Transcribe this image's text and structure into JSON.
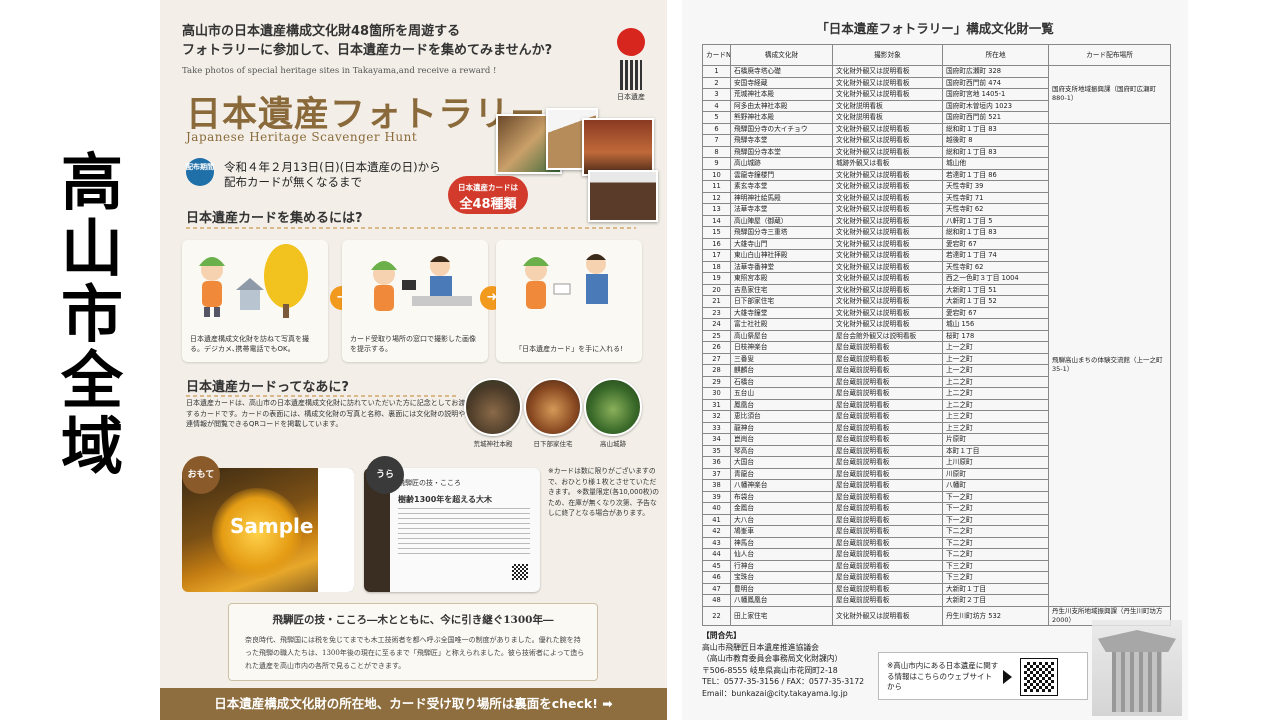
{
  "caption": {
    "chars": [
      "高",
      "山",
      "市",
      "全",
      "域"
    ]
  },
  "flyer": {
    "intro_line1": "高山市の日本遺産構成文化財48箇所を周遊する",
    "intro_line2": "フォトラリーに参加して、日本遺産カードを集めてみませんか?",
    "intro_en": "Take photos of special heritage sites in Takayama,and receive a reward !",
    "logo_caption": "日本遺産",
    "title": "日本遺産フォトラリー",
    "subtitle": "Japanese Heritage Scavenger Hunt",
    "period_badge": "配布期間",
    "period_line1": "令和４年２月13日(日)(日本遺産の日)から",
    "period_line2": "配布カードが無くなるまで",
    "count_badge_small": "日本遺産カードは",
    "count_badge_large": "全48種類",
    "how_heading": "日本遺産カードを集めるには?",
    "steps": [
      {
        "caption": "日本遺産構成文化財を訪ねて写真を撮る。デジカメ､携帯電話でもOK。"
      },
      {
        "caption": "カード受取り場所の窓口で撮影した画像を提示する。"
      },
      {
        "caption": "「日本遺産カード」を手に入れる!"
      }
    ],
    "about_heading": "日本遺産カードってなあに?",
    "about_text": "日本遺産カードは、高山市の日本遺産構成文化財に訪れていただいた方に記念としてお渡しするカードです。カードの表面には、構成文化財の写真と名称、裏面には文化財の説明や関連情報が閲覧できるQRコードを掲載しています。",
    "thumbs": [
      "荒城神社本殿",
      "日下部家住宅",
      "高山城跡"
    ],
    "front_label": "おもて",
    "back_label": "うら",
    "sample_text": "Sample",
    "card_back_title": "飛騨匠の技・こころ",
    "card_back_heading": "樹齢1300年を超える大木",
    "card_note": "※カードは数に限りがございますので、おひとり様１枚とさせていただきます。 ※数量限定(各10,000枚)のため、在庫が無くなり次第、予告なしに終了となる場合があります。",
    "story_heading": "飛騨匠の技・こころ―木とともに、今に引き継ぐ1300年―",
    "story_text": "奈良時代、飛騨国には税を免じてまでも木工技術者を都へ呼ぶ全国唯一の制度がありました。優れた腕を持った飛騨の職人たちは、1300年後の現在に至るまで「飛騨匠」と称えられました。彼ら技術者によって造られた遺産を高山市内の各所で見ることができます。",
    "bottom_bar": "日本遺産構成文化財の所在地、カード受け取り場所は裏面をcheck! ➡"
  },
  "page": {
    "title": "「日本遺産フォトラリー」構成文化財一覧",
    "headers": [
      "カードNo",
      "構成文化財",
      "撮影対象",
      "所在地",
      "カード配布場所"
    ],
    "rows": [
      [
        "1",
        "石橋廃寺塔心礎",
        "文化財外観又は説明看板",
        "国府町広瀬町 328"
      ],
      [
        "2",
        "安国寺経蔵",
        "文化財外観又は説明看板",
        "国府町西門前 474"
      ],
      [
        "3",
        "荒城神社本殿",
        "文化財外観又は説明看板",
        "国府町宮地 1405-1"
      ],
      [
        "4",
        "阿多由太神社本殿",
        "文化財説明看板",
        "国府町木曽垣内 1023"
      ],
      [
        "5",
        "熊野神社本殿",
        "文化財説明看板",
        "国府町西門前 521"
      ],
      [
        "6",
        "飛騨国分寺の大イチョウ",
        "文化財外観又は説明看板",
        "総和町１丁目 83"
      ],
      [
        "7",
        "飛騨寺本堂",
        "文化財外観又は説明看板",
        "越後町 8"
      ],
      [
        "8",
        "飛騨国分寺本堂",
        "文化財外観又は説明看板",
        "総和町１丁目 83"
      ],
      [
        "9",
        "高山城跡",
        "城跡外観又は看板",
        "城山他"
      ],
      [
        "10",
        "雲龍寺鐘楼門",
        "文化財外観又は説明看板",
        "若達町１丁目 86"
      ],
      [
        "11",
        "素玄寺本堂",
        "文化財外観又は説明看板",
        "天性寺町 39"
      ],
      [
        "12",
        "神明神社絵馬殿",
        "文化財外観又は説明看板",
        "天性寺町 71"
      ],
      [
        "13",
        "法華寺本堂",
        "文化財外観又は説明看板",
        "天性寺町 62"
      ],
      [
        "14",
        "高山陣屋（御蔵）",
        "文化財外観又は説明看板",
        "八軒町１丁目 5"
      ],
      [
        "15",
        "飛騨国分寺三重塔",
        "文化財外観又は説明看板",
        "総和町１丁目 83"
      ],
      [
        "16",
        "大雄寺山門",
        "文化財外観又は説明看板",
        "愛宕町 67"
      ],
      [
        "17",
        "東山白山神社拝殿",
        "文化財外観又は説明看板",
        "若達町１丁目 74"
      ],
      [
        "18",
        "法華寺番神堂",
        "文化財外観又は説明看板",
        "天性寺町 62"
      ],
      [
        "19",
        "東照宮本殿",
        "文化財外観又は説明看板",
        "西之一色町３丁目 1004"
      ],
      [
        "20",
        "吉島家住宅",
        "文化財外観又は説明看板",
        "大新町１丁目 51"
      ],
      [
        "21",
        "日下部家住宅",
        "文化財外観又は説明看板",
        "大新町１丁目 52"
      ],
      [
        "23",
        "大雄寺鐘堂",
        "文化財外観又は説明看板",
        "愛宕町 67"
      ],
      [
        "24",
        "富士社社殿",
        "文化財外観又は説明看板",
        "城山 156"
      ],
      [
        "25",
        "高山祭屋台",
        "屋台会館外観又は説明看板",
        "桜町 178"
      ],
      [
        "26",
        "日枝神楽台",
        "屋台蔵前説明看板",
        "上一之町"
      ],
      [
        "27",
        "三番叟",
        "屋台蔵前説明看板",
        "上一之町"
      ],
      [
        "28",
        "麒麟台",
        "屋台蔵前説明看板",
        "上一之町"
      ],
      [
        "29",
        "石橋台",
        "屋台蔵前説明看板",
        "上二之町"
      ],
      [
        "30",
        "五台山",
        "屋台蔵前説明看板",
        "上二之町"
      ],
      [
        "31",
        "鳳凰台",
        "屋台蔵前説明看板",
        "上二之町"
      ],
      [
        "32",
        "恵比須台",
        "屋台蔵前説明看板",
        "上三之町"
      ],
      [
        "33",
        "龍神台",
        "屋台蔵前説明看板",
        "上三之町"
      ],
      [
        "34",
        "崑崗台",
        "屋台蔵前説明看板",
        "片原町"
      ],
      [
        "35",
        "琴高台",
        "屋台蔵前説明看板",
        "本町１丁目"
      ],
      [
        "36",
        "大国台",
        "屋台蔵前説明看板",
        "上川原町"
      ],
      [
        "37",
        "青龍台",
        "屋台蔵前説明看板",
        "川原町"
      ],
      [
        "38",
        "八幡神楽台",
        "屋台蔵前説明看板",
        "八幡町"
      ],
      [
        "39",
        "布袋台",
        "屋台蔵前説明看板",
        "下一之町"
      ],
      [
        "40",
        "金鳳台",
        "屋台蔵前説明看板",
        "下一之町"
      ],
      [
        "41",
        "大八台",
        "屋台蔵前説明看板",
        "下一之町"
      ],
      [
        "42",
        "鳩峯車",
        "屋台蔵前説明看板",
        "下二之町"
      ],
      [
        "43",
        "神馬台",
        "屋台蔵前説明看板",
        "下二之町"
      ],
      [
        "44",
        "仙人台",
        "屋台蔵前説明看板",
        "下二之町"
      ],
      [
        "45",
        "行神台",
        "屋台蔵前説明看板",
        "下三之町"
      ],
      [
        "46",
        "宝珠台",
        "屋台蔵前説明看板",
        "下三之町"
      ],
      [
        "47",
        "豊明台",
        "屋台蔵前説明看板",
        "大新町１丁目"
      ],
      [
        "48",
        "八幡鳳凰台",
        "屋台蔵前説明看板",
        "大新町２丁目"
      ],
      [
        "22",
        "田上家住宅",
        "文化財外観又は説明看板",
        "丹生川町坊方 532"
      ]
    ],
    "dist_1": "国府支所地域振興課（国府町広瀬町 880-1）",
    "dist_2": "飛騨高山まちの体験交流館（上一之町 35-1）",
    "dist_3": "丹生川支所地域振興課（丹生川町坊方 2000）",
    "contact_heading": "【問合先】",
    "contact_lines": [
      "高山市飛騨匠日本遺産推進協議会",
      "（高山市教育委員会事務局文化財課内）",
      "〒506-8555 岐阜県高山市花岡町2-18",
      "TEL：0577-35-3156 / FAX：0577-35-3172",
      "Email：bunkazai@city.takayama.lg.jp"
    ],
    "web_note": "※高山市内にある日本遺産に関する情報はこちらのウェブサイトから"
  }
}
